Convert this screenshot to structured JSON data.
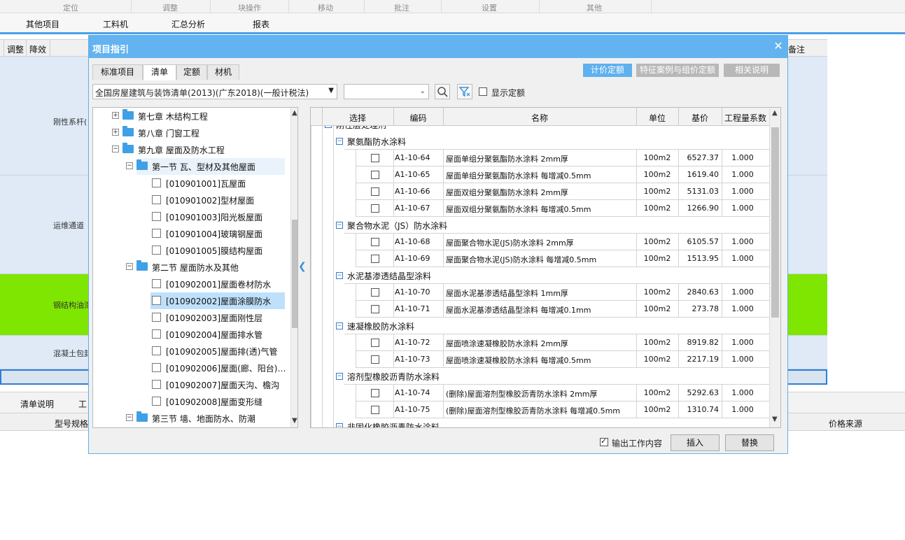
{
  "app": {
    "ribbon_groups": [
      "定位",
      "调整",
      "块操作",
      "移动",
      "批注",
      "设置",
      "其他"
    ],
    "tabs": [
      "其他项目",
      "工料机",
      "汇总分析",
      "报表"
    ],
    "grid_headers": [
      "调整",
      "降效",
      "备注"
    ],
    "grid_rows": [
      "刚性系杆(",
      "运维通道",
      "钢结构油漆",
      "混凝土包封"
    ],
    "bottom_tabs": [
      "清单说明",
      "工"
    ],
    "bottom_headers": [
      "型号规格",
      "价格来源"
    ],
    "colors": {
      "accent": "#4aa0ea",
      "highlight_row": "#7ee600"
    }
  },
  "dialog": {
    "title": "项目指引",
    "close_icon": "close-icon",
    "tabs": [
      "标准项目",
      "清单",
      "定额",
      "材机"
    ],
    "active_tab": "清单",
    "right_buttons": [
      "计价定额",
      "特征案例与组价定额",
      "相关说明"
    ],
    "library": "全国房屋建筑与装饰清单(2013)(广东2018)(一般计税法)",
    "search_value": "",
    "show_quota_label": "显示定额",
    "tree": [
      {
        "label": "第七章    木结构工程",
        "level": 0,
        "exp": "+",
        "folder": true
      },
      {
        "label": "第八章    门窗工程",
        "level": 0,
        "exp": "+",
        "folder": true
      },
      {
        "label": "第九章    屋面及防水工程",
        "level": 0,
        "exp": "-",
        "folder": true
      },
      {
        "label": "第一节    瓦、型材及其他屋面",
        "level": 1,
        "exp": "-",
        "folder": true,
        "hl": "light"
      },
      {
        "label": "[010901001]瓦屋面",
        "level": 2
      },
      {
        "label": "[010901002]型材屋面",
        "level": 2
      },
      {
        "label": "[010901003]阳光板屋面",
        "level": 2
      },
      {
        "label": "[010901004]玻璃钢屋面",
        "level": 2
      },
      {
        "label": "[010901005]膜结构屋面",
        "level": 2
      },
      {
        "label": "第二节    屋面防水及其他",
        "level": 1,
        "exp": "-",
        "folder": true
      },
      {
        "label": "[010902001]屋面卷材防水",
        "level": 2
      },
      {
        "label": "[010902002]屋面涂膜防水",
        "level": 2,
        "hl": "selected"
      },
      {
        "label": "[010902003]屋面刚性层",
        "level": 2
      },
      {
        "label": "[010902004]屋面排水管",
        "level": 2
      },
      {
        "label": "[010902005]屋面排(透)气管",
        "level": 2
      },
      {
        "label": "[010902006]屋面(廊、阳台)…",
        "level": 2
      },
      {
        "label": "[010902007]屋面天沟、檐沟",
        "level": 2
      },
      {
        "label": "[010902008]屋面变形缝",
        "level": 2
      },
      {
        "label": "第三节    墙、地面防水、防潮",
        "level": 1,
        "exp": "-",
        "folder": true
      }
    ],
    "grid_columns": [
      "选择",
      "编码",
      "名称",
      "单位",
      "基价",
      "工程量系数"
    ],
    "grid_partial_top": "刚性层处理剂",
    "grid_partial_bottom": "非固化橡胶沥青防水涂料",
    "grid_rows": [
      {
        "group": "聚氨酯防水涂料"
      },
      {
        "code": "A1-10-64",
        "name": "屋面单组分聚氨酯防水涂料 2mm厚",
        "unit": "100m2",
        "price": "6527.37",
        "factor": "1.000"
      },
      {
        "code": "A1-10-65",
        "name": "屋面单组分聚氨酯防水涂料 每增减0.5mm",
        "unit": "100m2",
        "price": "1619.40",
        "factor": "1.000"
      },
      {
        "code": "A1-10-66",
        "name": "屋面双组分聚氨酯防水涂料 2mm厚",
        "unit": "100m2",
        "price": "5131.03",
        "factor": "1.000"
      },
      {
        "code": "A1-10-67",
        "name": "屋面双组分聚氨酯防水涂料 每增减0.5mm",
        "unit": "100m2",
        "price": "1266.90",
        "factor": "1.000"
      },
      {
        "group": "聚合物水泥（JS）防水涂料"
      },
      {
        "code": "A1-10-68",
        "name": "屋面聚合物水泥(JS)防水涂料 2mm厚",
        "unit": "100m2",
        "price": "6105.57",
        "factor": "1.000"
      },
      {
        "code": "A1-10-69",
        "name": "屋面聚合物水泥(JS)防水涂料 每增减0.5mm",
        "unit": "100m2",
        "price": "1513.95",
        "factor": "1.000"
      },
      {
        "group": "水泥基渗透结晶型涂料"
      },
      {
        "code": "A1-10-70",
        "name": "屋面水泥基渗透结晶型涂料 1mm厚",
        "unit": "100m2",
        "price": "2840.63",
        "factor": "1.000"
      },
      {
        "code": "A1-10-71",
        "name": "屋面水泥基渗透结晶型涂料 每增减0.1mm",
        "unit": "100m2",
        "price": "273.78",
        "factor": "1.000"
      },
      {
        "group": "速凝橡胶防水涂料"
      },
      {
        "code": "A1-10-72",
        "name": "屋面喷涂速凝橡胶防水涂料 2mm厚",
        "unit": "100m2",
        "price": "8919.82",
        "factor": "1.000"
      },
      {
        "code": "A1-10-73",
        "name": "屋面喷涂速凝橡胶防水涂料 每增减0.5mm",
        "unit": "100m2",
        "price": "2217.19",
        "factor": "1.000"
      },
      {
        "group": "溶剂型橡胶沥青防水涂料"
      },
      {
        "code": "A1-10-74",
        "name": "(删除)屋面溶剂型橡胶沥青防水涂料 2mm厚",
        "unit": "100m2",
        "price": "5292.63",
        "factor": "1.000"
      },
      {
        "code": "A1-10-75",
        "name": "(删除)屋面溶剂型橡胶沥青防水涂料 每增减0.5mm",
        "unit": "100m2",
        "price": "1310.74",
        "factor": "1.000"
      }
    ],
    "footer": {
      "output_work_label": "输出工作内容",
      "output_work_checked": true,
      "insert_label": "插入",
      "replace_label": "替换"
    }
  }
}
